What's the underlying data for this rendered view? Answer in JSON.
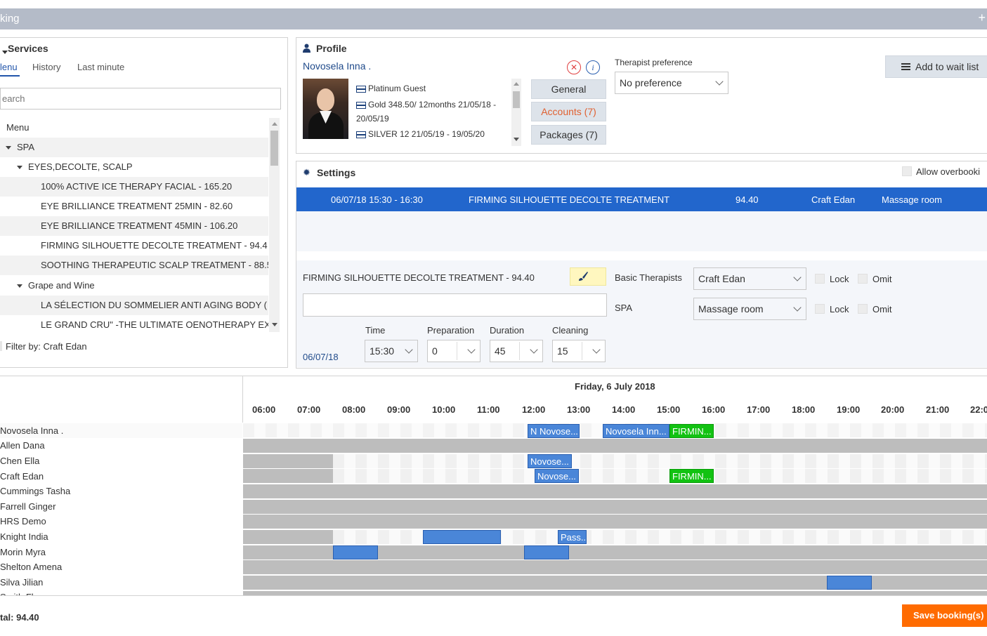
{
  "titlebar": {
    "title": "king",
    "plus": "+"
  },
  "services": {
    "title": "Services",
    "tabs": [
      "lenu",
      "History",
      "Last minute"
    ],
    "search_placeholder": "earch",
    "tree": [
      {
        "label": "Menu",
        "level": 0
      },
      {
        "label": "SPA",
        "level": 1
      },
      {
        "label": "EYES,DECOLTE, SCALP",
        "level": 2
      },
      {
        "label": "100% ACTIVE ICE THERAPY FACIAL - 165.20",
        "level": 3
      },
      {
        "label": "EYE BRILLIANCE TREATMENT 25MIN - 82.60",
        "level": 3
      },
      {
        "label": "EYE BRILLIANCE TREATMENT 45MIN - 106.20",
        "level": 3
      },
      {
        "label": "FIRMING SILHOUETTE DECOLTE TREATMENT - 94.4",
        "level": 3
      },
      {
        "label": "SOOTHING THERAPEUTIC SCALP TREATMENT - 88.5",
        "level": 3
      },
      {
        "label": "Grape and Wine",
        "level": 2
      },
      {
        "label": "LA SÉLECTION DU SOMMELIER ANTI AGING BODY (",
        "level": 3
      },
      {
        "label": "LE GRAND CRU\" -THE ULTIMATE OENOTHERAPY EX",
        "level": 3
      }
    ],
    "filter": "Filter by: Craft Edan"
  },
  "profile": {
    "title": "Profile",
    "guest_name": "Novosela Inna .",
    "memberships": [
      "Platinum Guest",
      "Gold 348.50/ 12months 21/05/18 -",
      "20/05/19",
      "SILVER 12 21/05/19 - 19/05/20"
    ],
    "buttons": {
      "general": "General",
      "accounts": "Accounts (7)",
      "packages": "Packages (7)"
    },
    "therapist_pref_label": "Therapist preference",
    "therapist_pref_value": "No preference",
    "wait_list": "Add to wait list"
  },
  "settings": {
    "title": "Settings",
    "allow_overbooking": "Allow overbooki",
    "booking": {
      "datetime": "06/07/18 15:30 - 16:30",
      "service": "FIRMING SILHOUETTE DECOLTE TREATMENT",
      "price": "94.40",
      "therapist": "Craft Edan",
      "room": "Massage room"
    },
    "detail_title": "FIRMING SILHOUETTE DECOLTE TREATMENT - 94.40",
    "basic_therapists_label": "Basic Therapists",
    "therapist_value": "Craft Edan",
    "spa_label": "SPA",
    "room_value": "Massage room",
    "lock": "Lock",
    "omit": "Omit",
    "date": "06/07/18",
    "time_label": "Time",
    "time_value": "15:30",
    "prep_label": "Preparation",
    "prep_value": "0",
    "duration_label": "Duration",
    "duration_value": "45",
    "cleaning_label": "Cleaning",
    "cleaning_value": "15"
  },
  "schedule": {
    "date_title": "Friday, 6 July 2018",
    "hours": [
      "06:00",
      "07:00",
      "08:00",
      "09:00",
      "10:00",
      "11:00",
      "12:00",
      "13:00",
      "14:00",
      "15:00",
      "16:00",
      "17:00",
      "18:00",
      "19:00",
      "20:00",
      "21:00",
      "22:0"
    ],
    "names": [
      "Novosela Inna .",
      "Allen Dana",
      "Chen Ella",
      "Craft Edan",
      "Cummings Tasha",
      "Farrell Ginger",
      "HRS Demo",
      "Knight India",
      "Morin Myra",
      "Shelton Amena",
      "Silva Jilian",
      "Smith Fl..."
    ],
    "appointments": {
      "a1": "N Novose...",
      "a2": "Novosela Inn...",
      "a3": "FIRMIN...",
      "a4": "Novose...",
      "a5": "Novose...",
      "a6": "FIRMIN...",
      "a7": "Pass..."
    }
  },
  "footer": {
    "total": "tal: 94.40",
    "save": "Save booking(s)"
  },
  "colors": {
    "accent": "#2266cc",
    "save": "#ff6b00",
    "appt_blue": "#4a86d8",
    "appt_green": "#12c212"
  }
}
